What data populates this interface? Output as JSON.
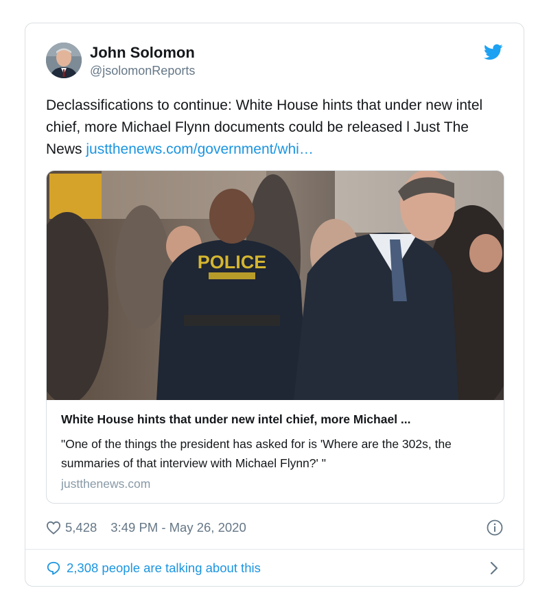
{
  "tweet": {
    "author_name": "John Solomon",
    "author_handle": "@jsolomonReports",
    "text": "Declassifications to continue: White House hints that under new intel chief, more Michael Flynn documents could be released l Just The News ",
    "link_text": "justthenews.com/government/whi…"
  },
  "link_card": {
    "image_badge_text": "POLICE",
    "title": "White House hints that under new intel chief, more Michael ...",
    "description": "\"One of the things the president has asked for is 'Where are the 302s, the summaries of that interview with Michael Flynn?' \"",
    "domain": "justthenews.com"
  },
  "meta": {
    "likes": "5,428",
    "timestamp": "3:49 PM - May 26, 2020"
  },
  "footer": {
    "conversation_text": "2,308 people are talking about this"
  },
  "icons": {
    "brand": "twitter-bird-icon",
    "like": "heart-icon",
    "info": "info-icon",
    "reply": "speech-bubble-icon",
    "chevron": "chevron-right-icon"
  },
  "colors": {
    "link": "#1b95e0",
    "secondary_text": "#657786",
    "border": "#d9dfe3"
  }
}
